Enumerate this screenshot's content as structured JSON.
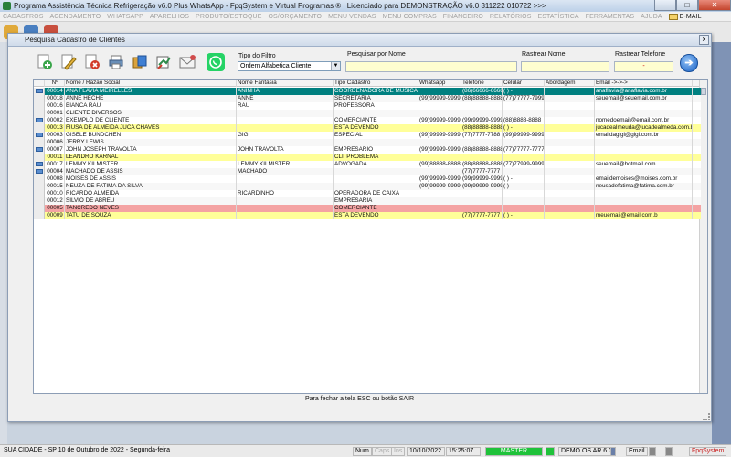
{
  "app": {
    "title": "Programa Assistência Técnica Refrigeração v6.0 Plus WhatsApp - FpqSystem e Virtual Programas ® | Licenciado para  DEMONSTRAÇÃO v6.0 311222 010722 >>>",
    "minimize": "─",
    "maximize": "□",
    "close": "✕"
  },
  "menu": [
    "CADASTROS",
    "AGENDAMENTO",
    "WHATSAPP",
    "APARELHOS",
    "PRODUTO/ESTOQUE",
    "OS/ORÇAMENTO",
    "MENU VENDAS",
    "MENU COMPRAS",
    "FINANCEIRO",
    "RELATÓRIOS",
    "ESTATÍSTICA",
    "FERRAMENTAS",
    "AJUDA",
    "E-MAIL"
  ],
  "dialog": {
    "title": "Pesquisa Cadastro de Clientes",
    "close": "x",
    "footnote": "Para fechar a tela ESC ou botão SAIR"
  },
  "actions": [
    {
      "name": "add-icon",
      "color": "#3aa54a"
    },
    {
      "name": "edit-icon",
      "color": "#e3b23c"
    },
    {
      "name": "delete-icon",
      "color": "#d23b2a"
    },
    {
      "name": "print-icon",
      "color": "#6a8fb8"
    },
    {
      "name": "copy-icon",
      "color": "#3f7fd3"
    },
    {
      "name": "export-icon",
      "color": "#2f8a4a"
    },
    {
      "name": "email-icon",
      "color": "#d14c4c"
    },
    {
      "name": "whatsapp-icon",
      "color": "#25d366"
    }
  ],
  "filters": {
    "tipo_label": "Tipo do Filtro",
    "tipo_value": "Ordem Alfabetica Cliente",
    "nome_label": "Pesquisar por Nome",
    "rastrear_nome_label": "Rastrear Nome",
    "rastrear_tel_label": "Rastrear Telefone",
    "rastrear_tel_value": "-"
  },
  "columns": [
    "Nº",
    "Nome / Razão Social",
    "Nome Fantasia",
    "Tipo Cadastro",
    "Whatsapp",
    "Telefone",
    "Celular",
    "Abordagem",
    "Email ->->->"
  ],
  "rows": [
    {
      "n": "00014",
      "nome": "ANA FLAVIA MEIRELLES",
      "fantasia": "ANINHA",
      "tipo": "COORDENADORA DE MUSICA",
      "whats": "",
      "tel": "(86)66666-6666",
      "cel": "(  )    -",
      "abord": "",
      "email": "anaflavia@anaflavia.com.br",
      "style": "sel",
      "mail": true
    },
    {
      "n": "00018",
      "nome": "ANNE HECHE",
      "fantasia": "ANNE",
      "tipo": "SECRETARIA",
      "whats": "(99)99999-9999",
      "tel": "(88)88888-8888",
      "cel": "(77)77777-7999",
      "abord": "",
      "email": "seuemail@seuemail.com.br",
      "style": "",
      "mail": false
    },
    {
      "n": "00016",
      "nome": "BIANCA RAU",
      "fantasia": "RAU",
      "tipo": "PROFESSORA",
      "whats": "",
      "tel": "",
      "cel": "",
      "abord": "",
      "email": "",
      "style": "",
      "mail": false
    },
    {
      "n": "00001",
      "nome": "CLIENTE DIVERSOS",
      "fantasia": "",
      "tipo": "",
      "whats": "",
      "tel": "",
      "cel": "",
      "abord": "",
      "email": "",
      "style": "",
      "mail": false
    },
    {
      "n": "00002",
      "nome": "EXEMPLO DE CLIENTE",
      "fantasia": "",
      "tipo": "COMERCIANTE",
      "whats": "(99)99999-9999",
      "tel": "(99)99999-9999",
      "cel": "(88)8888-8888",
      "abord": "",
      "email": "nomedoemail@email.com.br",
      "style": "",
      "mail": true
    },
    {
      "n": "00013",
      "nome": "FIUSA DE ALMEIDA JUCA CHAVES",
      "fantasia": "",
      "tipo": "ESTA DEVENDO",
      "whats": "",
      "tel": "(88)88888-8888",
      "cel": "(  )    -",
      "abord": "",
      "email": "jucadealmeuda@jucadealmeda.com.br",
      "style": "yellow",
      "mail": false
    },
    {
      "n": "00003",
      "nome": "GISELE BUNDCHEN",
      "fantasia": "GIGI",
      "tipo": "ESPECIAL",
      "whats": "(99)99999-9999",
      "tel": "(77)7777-7788",
      "cel": "(99)99999-9999",
      "abord": "",
      "email": "emaildagigi@gigi.com.br",
      "style": "",
      "mail": true
    },
    {
      "n": "00006",
      "nome": "JERRY LEWIS",
      "fantasia": "",
      "tipo": "",
      "whats": "",
      "tel": "",
      "cel": "",
      "abord": "",
      "email": "",
      "style": "",
      "mail": false
    },
    {
      "n": "00007",
      "nome": "JOHN JOSEPH TRAVOLTA",
      "fantasia": "JOHN TRAVOLTA",
      "tipo": "EMPRESARIO",
      "whats": "(99)99999-9999",
      "tel": "(88)88888-8888",
      "cel": "(77)77777-7777",
      "abord": "",
      "email": "",
      "style": "",
      "mail": true
    },
    {
      "n": "00011",
      "nome": "LEANDRO KARNAL",
      "fantasia": "",
      "tipo": "CLI. PROBLEMA",
      "whats": "",
      "tel": "",
      "cel": "",
      "abord": "",
      "email": "",
      "style": "yellow",
      "mail": false
    },
    {
      "n": "00017",
      "nome": "LEMMY KILMISTER",
      "fantasia": "LEMMY KILMISTER",
      "tipo": "ADVOGADA",
      "whats": "(99)88888-8888",
      "tel": "(88)88888-8888",
      "cel": "(77)77999-9999",
      "abord": "",
      "email": "seuemail@hotmail.com",
      "style": "",
      "mail": true
    },
    {
      "n": "00004",
      "nome": "MACHADO DE ASSIS",
      "fantasia": "MACHADO",
      "tipo": "",
      "whats": "",
      "tel": "(77)7777-7777",
      "cel": "",
      "abord": "",
      "email": "",
      "style": "",
      "mail": true
    },
    {
      "n": "00008",
      "nome": "MOISES DE ASSIS",
      "fantasia": "",
      "tipo": "",
      "whats": "(99)99999-9999",
      "tel": "(99)99999-9999",
      "cel": "(  )    -",
      "abord": "",
      "email": "emaildemoises@moises.com.br",
      "style": "",
      "mail": false
    },
    {
      "n": "00015",
      "nome": "NEUZA DE FATIMA DA SILVA",
      "fantasia": "",
      "tipo": "",
      "whats": "(99)99999-9999",
      "tel": "(99)99999-9999",
      "cel": "(  )    -",
      "abord": "",
      "email": "neusadefatima@fatima.com.br",
      "style": "",
      "mail": false
    },
    {
      "n": "00010",
      "nome": "RICARDO ALMEIDA",
      "fantasia": "RICARDINHO",
      "tipo": "OPERADORA DE CAIXA",
      "whats": "",
      "tel": "",
      "cel": "",
      "abord": "",
      "email": "",
      "style": "",
      "mail": false
    },
    {
      "n": "00012",
      "nome": "SILVIO DE ABREU",
      "fantasia": "",
      "tipo": "EMPRESARIA",
      "whats": "",
      "tel": "",
      "cel": "",
      "abord": "",
      "email": "",
      "style": "",
      "mail": false
    },
    {
      "n": "00005",
      "nome": "TANCREDO NEVES",
      "fantasia": "",
      "tipo": "COMERCIANTE",
      "whats": "",
      "tel": "",
      "cel": "",
      "abord": "",
      "email": "",
      "style": "red",
      "mail": false
    },
    {
      "n": "00009",
      "nome": "TATU DE SOUZA",
      "fantasia": "",
      "tipo": "ESTA DEVENDO",
      "whats": "",
      "tel": "(77)7777-7777",
      "cel": "(  )    -",
      "abord": "",
      "email": "meuemail@email.com.b",
      "style": "yellow",
      "mail": false
    }
  ],
  "status": {
    "city": "SUA CIDADE - SP 10 de Outubro de 2022 - Segunda-feira",
    "num": "Num",
    "caps": "Caps",
    "ins": "Ins",
    "date": "10/10/2022",
    "time": "15:25:07",
    "master": "MASTER",
    "demo": "DEMO OS AR 6.0",
    "email": "Email",
    "brand": "FpqSystem"
  },
  "colors": {
    "selected_row": "#008080",
    "yellow_row": "#ffff99",
    "red_row": "#f4a3a3",
    "accent": "#1b63c6"
  }
}
